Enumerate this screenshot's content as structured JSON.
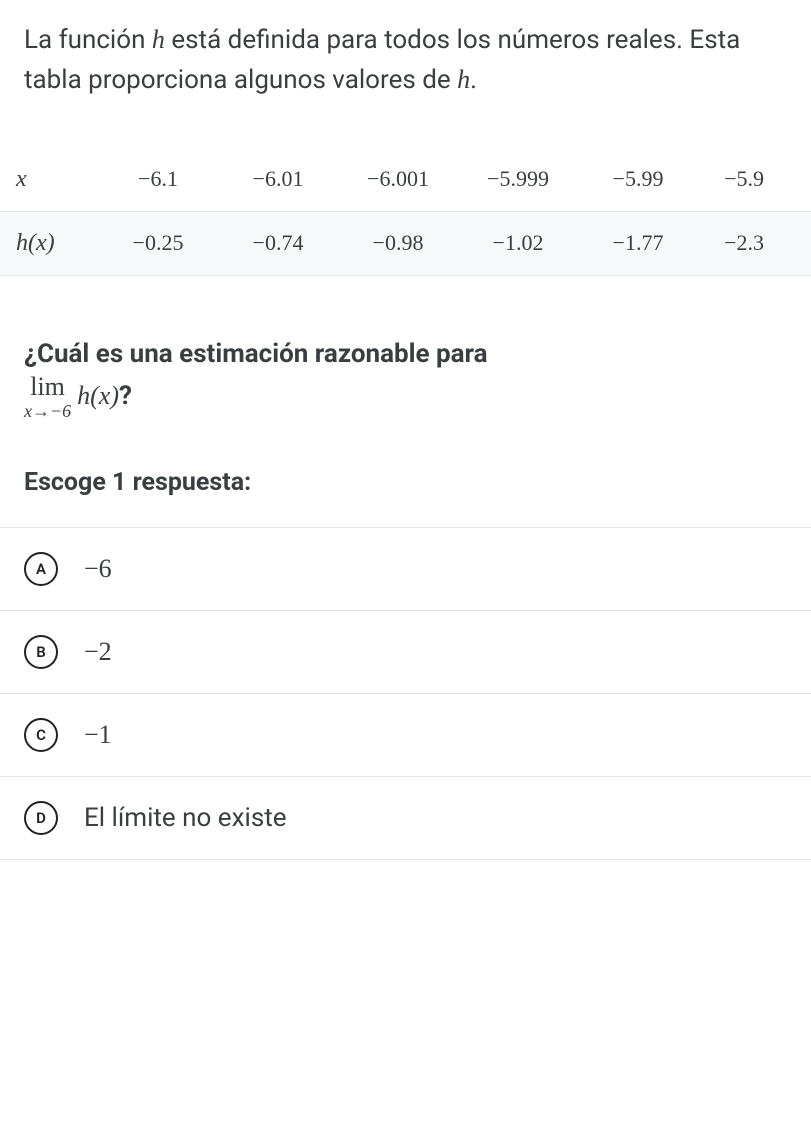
{
  "intro": {
    "part1": "La función ",
    "func": "h",
    "part2": " está definida para todos los números reales. Esta tabla proporciona algunos valores de ",
    "func2": "h",
    "part3": "."
  },
  "table": {
    "head_x": "x",
    "head_hx": "h(x)",
    "x": [
      "−6.1",
      "−6.01",
      "−6.001",
      "−5.999",
      "−5.99",
      "−5.9"
    ],
    "hx": [
      "−0.25",
      "−0.74",
      "−0.98",
      "−1.02",
      "−1.77",
      "−2.3"
    ]
  },
  "question": {
    "part1": "¿Cuál es una estimación razonable para",
    "lim": "lim",
    "approach": "x→−6",
    "expr": "h(x)",
    "qmark": "?"
  },
  "choose": "Escoge 1 respuesta:",
  "choices": {
    "A": {
      "letter": "A",
      "label": "−6"
    },
    "B": {
      "letter": "B",
      "label": "−2"
    },
    "C": {
      "letter": "C",
      "label": "−1"
    },
    "D": {
      "letter": "D",
      "label": "El límite no existe"
    }
  }
}
